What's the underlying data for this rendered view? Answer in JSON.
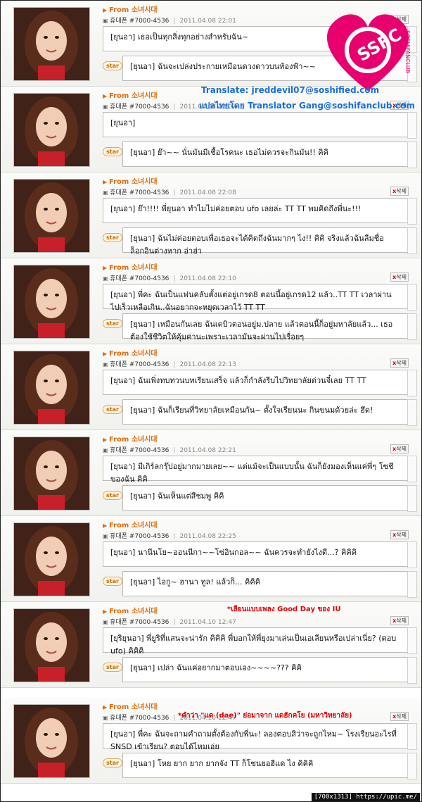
{
  "comments": [
    {
      "from": "From 소녀시대",
      "phone": "휴대폰 #7000-4536",
      "date": "2011.04.08 22:01",
      "comment": "[ยุนอา] เธอเป็นทุกสิ่งทุกอย่างสำหรับฉัน~",
      "reply": "[ยุนอา] ฉันจะเปล่งประกายเหมือนดวงดาวบนท้องฟ้า~~"
    },
    {
      "from": "From 소녀시대",
      "phone": "휴대폰 #7000-4536",
      "date": "2011.04.08 22:07",
      "comment": "[ยุนอา]",
      "reply": "[ยุนอา] ย๊า~~ นั่นมันมีเชื้อโรคนะ เธอไม่ควรจะกินมัน!! คิคิ"
    },
    {
      "from": "From 소녀시대",
      "phone": "휴대폰 #7000-4536",
      "date": "2011.04.08 22:08",
      "comment": "[ยุนอา] ย๊า!!!! พี่ยุนอา ทำไมไม่ค่อยตอบ ufo เลยล่ะ TT TT พมคิดถึงพี่นะ!!!",
      "reply": "[ยุนอา] ฉันไม่ค่อยตอบเพื่อเธอจะได้คิดถึงฉันมากๆ ไง!! คิคิ จริงแล้วฉันลืมชื่อล็อกอินต่างหาก อ่าฮ่า"
    },
    {
      "from": "From 소녀시대",
      "phone": "휴대폰 #7000-4536",
      "date": "2011.04.08 22:10",
      "comment": "[ยุนอา] พี่คะ ฉันเป็นแฟนคลับตั้งแต่อยู่เกรด8 ตอนนี้อยู่เกรด12 แล้ว..TT TT เวลาผ่านไปเร็วเหลือเกิน..ฉันอยากจะหยุดเวลาไว้ TT TT",
      "reply": "[ยุนอา] เหมือนกันเลย ฉันเดบิวตอนอยู่ม.ปลาย แล้วตอนนี้ก็อยู่มหาลัยแล้ว... เธอต้องใช้ชีวิตให้คุ้มค่านะเพราะเวลามันจะผ่านไปเรื่อยๆ"
    },
    {
      "from": "From 소녀시대",
      "phone": "휴대폰 #7000-4536",
      "date": "2011.04.08 22:13",
      "comment": "[ยุนอา] ฉันเพิ่งทบทวนบทเรียนเสร็จ แล้วก็กำลังรีบไปวิทยาลัยด่วนจี๋เลย TT TT",
      "reply": "[ยุนอา] ฉันก็เรียนที่วิทยาลัยเหมือนกัน~ ตั้งใจเรียนนะ กินขนมด้วยล่ะ ฮึด!"
    },
    {
      "from": "From 소녀시대",
      "phone": "휴대폰 #7000-4536",
      "date": "2011.04.08 22:21",
      "comment": "[ยุนอา] มีเกิร์ลกรุ๊ปอยู่มากมายเลย~~ แต่แม้จะเป็นแบบนั้น ฉันก็ยังมองเห็นแค่พี่ๆ โซชีของฉัน คิคิ",
      "reply": "[ยุนอา] ฉันเห็นแต่สีชมพู คิคิ"
    },
    {
      "from": "From 소녀시대",
      "phone": "휴대폰 #7000-4536",
      "date": "2011.04.08 22:25",
      "comment": "[ยุนอา] นานีนโย~ออนนีกา~~โซ่อินกอล~~ ฉันควรจะทำยังไงดี...? คิคิคิ",
      "reply": "[ยุนอา] ไอกู~ ฮานา ทูล! แล้วก็... คิคิคิ"
    },
    {
      "from": "From 소녀시대",
      "phone": "휴대폰 #7000-4536",
      "date": "2011.04.10 12:47",
      "comment": "[ยุริยุนอา] พี่ยูริที่แสนจะน่ารัก คิคิคิ พี่บอกให้พี่ยุงมาเล่นเป็นเอเลียนหรือเปล่าเนี่ย? (ตอบ ufo) คิคิคิ",
      "reply": "[ยุนอา] เปล่า ฉันแค่อยากมาตอบเอง~~~~??? คิคิ"
    },
    {
      "from": "From 소녀시대",
      "phone": "휴대폰 #7000-4536",
      "date": "2011.04.10 12:47",
      "comment": "[ยุนอา] พี่คะ ฉันจะถามคำถามตั้งต้องกับพี่นะ! ลองตอบสิว่าจะถูกไหม~ โรงเรียนอะไรที่ SNSD เข้าเรียน? ตอบได้ไหมเอ่ย",
      "reply": "[ยุนอา] โหย ยาก ยาก ยากจัง TT ก็โซนยอฮีแด ไง คิคิคิ"
    }
  ],
  "labels": {
    "delete": "삭제",
    "star": "star",
    "translate": "Translate: jreddevil07@soshified.com",
    "translate_th": "แปลไทยโดย Translator Gang@soshifanclub.com",
    "note_song": "*เลียนแบบเพลง Good Day ของ IU",
    "note_dae": "*คำว่า \"แด (dae)\" ย่อมาจาก แดฮักคโย (มหาวิทยาลัย)",
    "logo_text": "SSFC",
    "logo_sub": "SOSHIFANCLUB",
    "footer": "[700x1313] https://upic.me/"
  },
  "colors": {
    "from": "#e26b0a",
    "translate": "#1a6fe0",
    "note": "#e00000",
    "logo": "#e8006e"
  }
}
